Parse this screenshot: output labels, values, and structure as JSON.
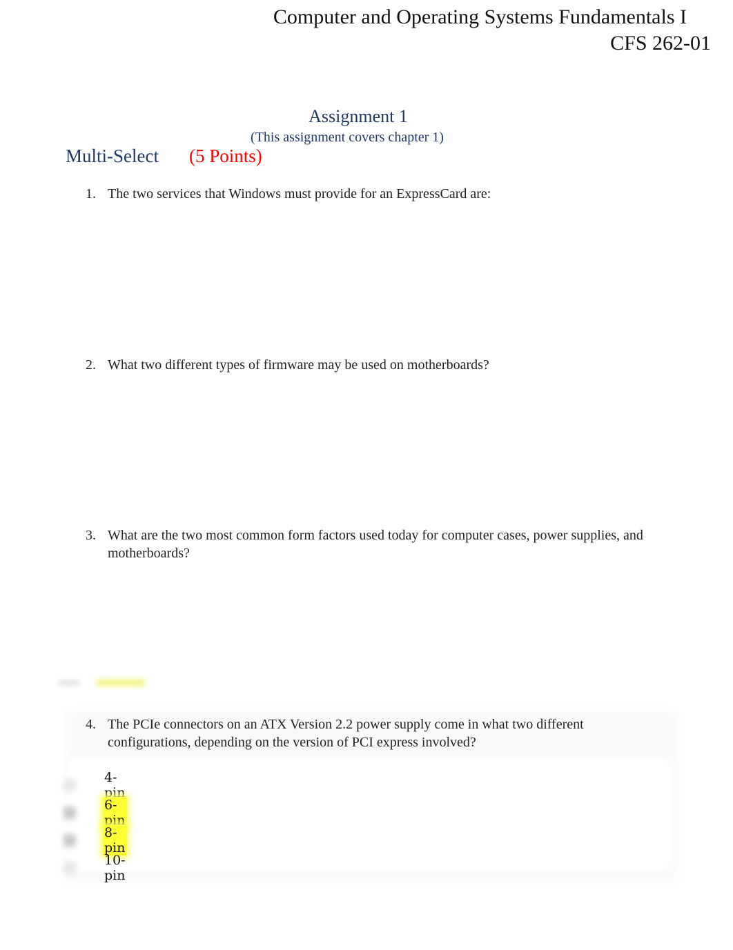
{
  "header": {
    "course_title": "Computer and Operating Systems Fundamentals I",
    "course_code": "CFS 262-01"
  },
  "assignment": {
    "title": "Assignment 1",
    "subtitle": "(This assignment covers chapter 1)"
  },
  "section": {
    "label": "Multi-Select",
    "points": "(5 Points)",
    "colors": {
      "label": "#1f3864",
      "points": "#ff0000",
      "highlight": "#ffff33"
    }
  },
  "questions": [
    {
      "number": "1.",
      "text": "The two services that Windows must provide for an ExpressCard are:"
    },
    {
      "number": "2.",
      "text": "What two different types of firmware may be used on motherboards?"
    },
    {
      "number": "3.",
      "text": "What are the two most common form factors used today for computer cases, power supplies, and motherboards?"
    },
    {
      "number": "4.",
      "text": "The PCIe connectors on an ATX Version 2.2 power supply come in what two different configurations, depending on the version of PCI express involved?",
      "options": [
        {
          "label": "4-pin",
          "checked": false,
          "highlighted": false
        },
        {
          "label": "6-pin",
          "checked": true,
          "highlighted": true
        },
        {
          "label": "8-pin",
          "checked": true,
          "highlighted": true
        },
        {
          "label": "10-pin",
          "checked": false,
          "highlighted": false
        }
      ]
    }
  ]
}
